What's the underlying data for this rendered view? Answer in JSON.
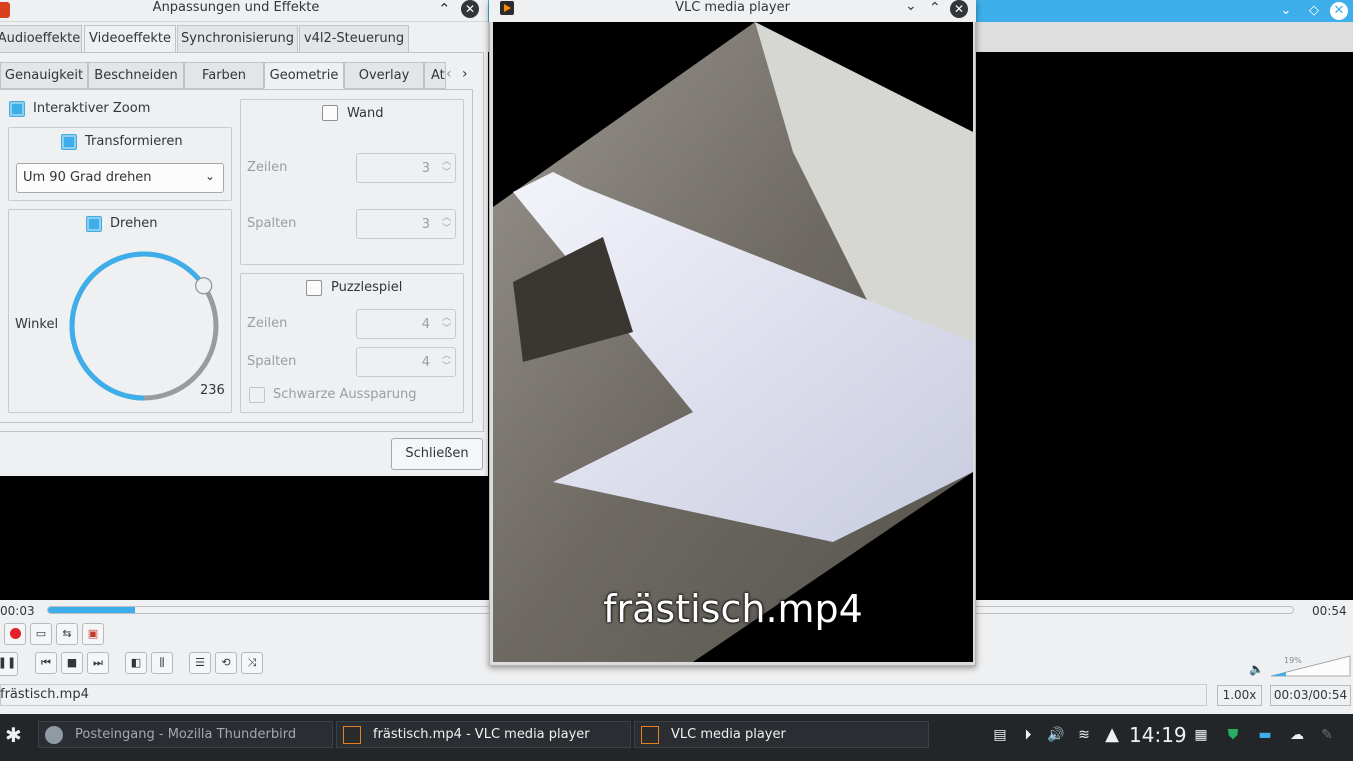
{
  "background_player": {
    "elapsed": "00:03",
    "total": "00:54",
    "progress": 0.07,
    "status_file": "frästisch.mp4",
    "speed": "1.00x",
    "time_box": "00:03/00:54",
    "volume_percent": "19%",
    "accent": "#3daee9"
  },
  "effects_dialog": {
    "title": "Anpassungen und Effekte",
    "tabs": [
      "Audioeffekte",
      "Videoeffekte",
      "Synchronisierung",
      "v4l2-Steuerung"
    ],
    "active_tab": "Videoeffekte",
    "subtabs": [
      "Genauigkeit",
      "Beschneiden",
      "Farben",
      "Geometrie",
      "Overlay",
      "At"
    ],
    "active_subtab": "Geometrie",
    "interactive_zoom_label": "Interaktiver Zoom",
    "transform_label": "Transformieren",
    "transform_option": "Um 90 Grad drehen",
    "rotate_label": "Drehen",
    "angle_label": "Winkel",
    "angle_value": "236",
    "angle_degrees": 236,
    "wall_label": "Wand",
    "wall_rows_label": "Zeilen",
    "wall_rows_value": "3",
    "wall_cols_label": "Spalten",
    "wall_cols_value": "3",
    "puzzle_label": "Puzzlespiel",
    "puzzle_rows_label": "Zeilen",
    "puzzle_rows_value": "4",
    "puzzle_cols_label": "Spalten",
    "puzzle_cols_value": "4",
    "black_slot_label": "Schwarze Aussparung",
    "close_button": "Schließen"
  },
  "video_window": {
    "title": "VLC media player",
    "caption": "frästisch.mp4"
  },
  "taskbar": {
    "tasks": [
      {
        "label": "Posteingang - Mozilla Thunderbird",
        "icon": "thunderbird-icon"
      },
      {
        "label": "frästisch.mp4 - VLC media player",
        "icon": "vlc-icon"
      },
      {
        "label": "VLC media player",
        "icon": "vlc-icon"
      }
    ],
    "clock": "14:19"
  }
}
